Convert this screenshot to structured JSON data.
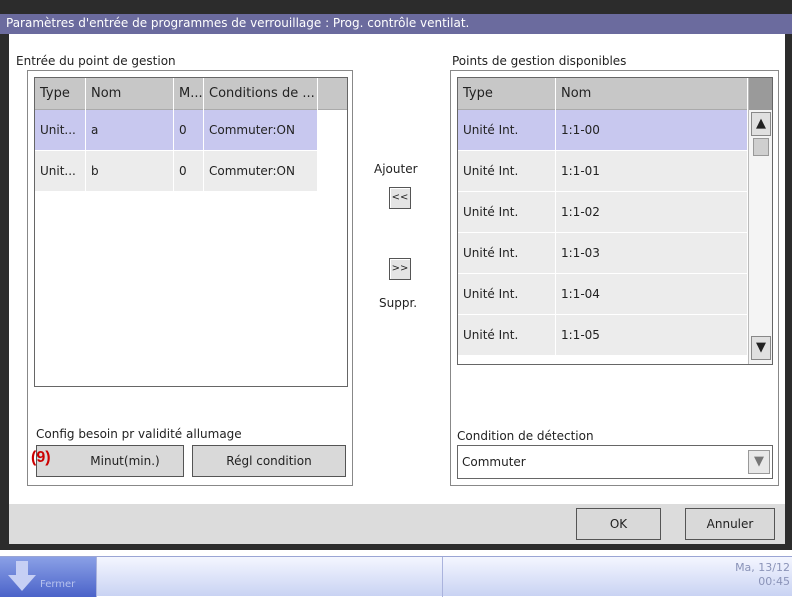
{
  "dialog": {
    "title": "Paramètres d'entrée de programmes de verrouillage : Prog. contrôle ventilat."
  },
  "left_panel": {
    "title": "Entrée du point de gestion",
    "columns": [
      "Type",
      "Nom",
      "M...",
      "Conditions de ..."
    ],
    "rows": [
      {
        "type": "Unit...",
        "nom": "a",
        "m": "0",
        "cond": "Commuter:ON",
        "selected": true
      },
      {
        "type": "Unit...",
        "nom": "b",
        "m": "0",
        "cond": "Commuter:ON",
        "selected": false
      }
    ],
    "validity_label": "Config besoin pr validité allumage",
    "timer_button": "Minut(min.)",
    "condition_button": "Régl condition",
    "annotation": "(9)"
  },
  "middle": {
    "add_label": "Ajouter",
    "add_button": "<<",
    "remove_button": ">>",
    "remove_label": "Suppr."
  },
  "right_panel": {
    "title": "Points de gestion disponibles",
    "columns": [
      "Type",
      "Nom"
    ],
    "rows": [
      {
        "type": "Unité Int.",
        "nom": "1:1-00",
        "selected": true
      },
      {
        "type": "Unité Int.",
        "nom": "1:1-01",
        "selected": false
      },
      {
        "type": "Unité Int.",
        "nom": "1:1-02",
        "selected": false
      },
      {
        "type": "Unité Int.",
        "nom": "1:1-03",
        "selected": false
      },
      {
        "type": "Unité Int.",
        "nom": "1:1-04",
        "selected": false
      },
      {
        "type": "Unité Int.",
        "nom": "1:1-05",
        "selected": false
      }
    ],
    "detection_label": "Condition de détection",
    "detection_value": "Commuter"
  },
  "footer": {
    "ok_label": "OK",
    "cancel_label": "Annuler"
  },
  "taskbar": {
    "left_label": "Fermer",
    "datetime_line1": "Ma, 13/12",
    "datetime_line2": "00:45"
  },
  "colors": {
    "title_bar": "#6b6b9e",
    "selected_row": "#c8c8ef",
    "annotation": "#cc0000"
  }
}
